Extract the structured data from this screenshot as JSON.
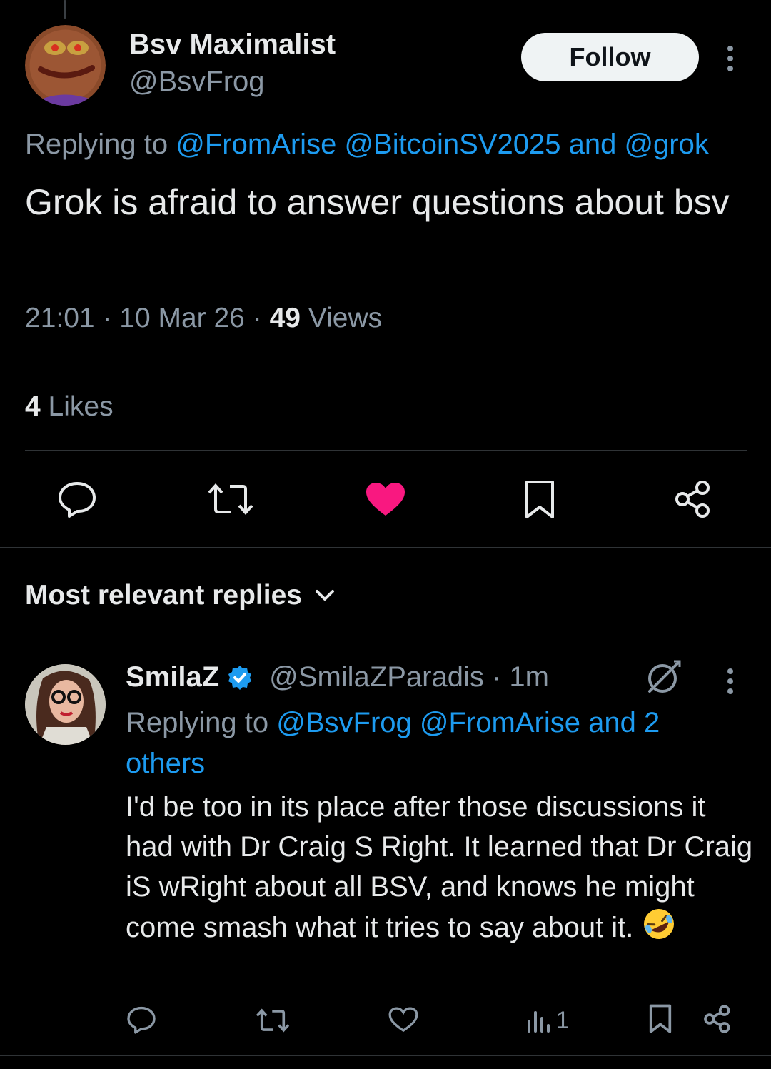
{
  "main_tweet": {
    "display_name": "Bsv Maximalist",
    "handle": "@BsvFrog",
    "follow_label": "Follow",
    "replying_prefix": "Replying to",
    "replying_handles": [
      "@FromArise",
      "@BitcoinSV2025"
    ],
    "replying_and": "and",
    "replying_last": "@grok",
    "text": "Grok is afraid to answer questions about bsv",
    "time": "21:01",
    "date": "10 Mar 26",
    "views_count": "49",
    "views_label": "Views",
    "likes_count": "4",
    "likes_label": "Likes",
    "liked": true,
    "like_color": "#f91880"
  },
  "replies_section": {
    "sort_label": "Most relevant replies"
  },
  "reply": {
    "display_name": "SmilaZ",
    "verified": true,
    "verified_color": "#1d9bf0",
    "handle": "@SmilaZParadis",
    "age": "1m",
    "replying_prefix": "Replying to",
    "replying_handles": [
      "@BsvFrog",
      "@FromArise"
    ],
    "replying_tail": "and 2 others",
    "text": "I'd be too in its place after those discussions it had with Dr Craig S Right. It learned that Dr Craig iS wRight about all BSV, and knows he might come smash what it tries to say about it.",
    "emoji": "rolling-on-floor-laughing",
    "views_count": "1"
  },
  "colors": {
    "background": "#000000",
    "link": "#1d9bf0",
    "muted": "#8b98a5",
    "divider": "#2f3336"
  }
}
